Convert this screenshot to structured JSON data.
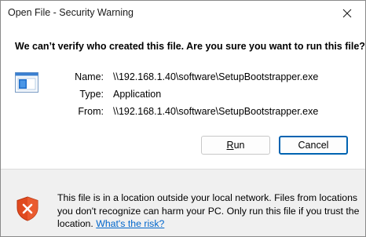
{
  "window": {
    "title": "Open File - Security Warning",
    "close_glyph": "✕"
  },
  "dialog": {
    "question": "We can’t verify who created this file. Are you sure you want to run this file?",
    "icon": "application-file-icon",
    "fields": [
      {
        "label": "Name:",
        "value": "\\\\192.168.1.40\\software\\SetupBootstrapper.exe"
      },
      {
        "label": "Type:",
        "value": "Application"
      },
      {
        "label": "From:",
        "value": "\\\\192.168.1.40\\software\\SetupBootstrapper.exe"
      }
    ],
    "buttons": {
      "run_mnemonic": "R",
      "run_rest": "un",
      "cancel": "Cancel"
    }
  },
  "footer": {
    "icon": "shield-warning-icon",
    "message": "This file is in a location outside your local network. Files from locations you don't recognize can harm your PC. Only run this file if you trust the location.",
    "link": "What's the risk?"
  },
  "colors": {
    "link": "#0066cc",
    "shield": "#e04a1f",
    "default_button_border": "#0063b1"
  }
}
